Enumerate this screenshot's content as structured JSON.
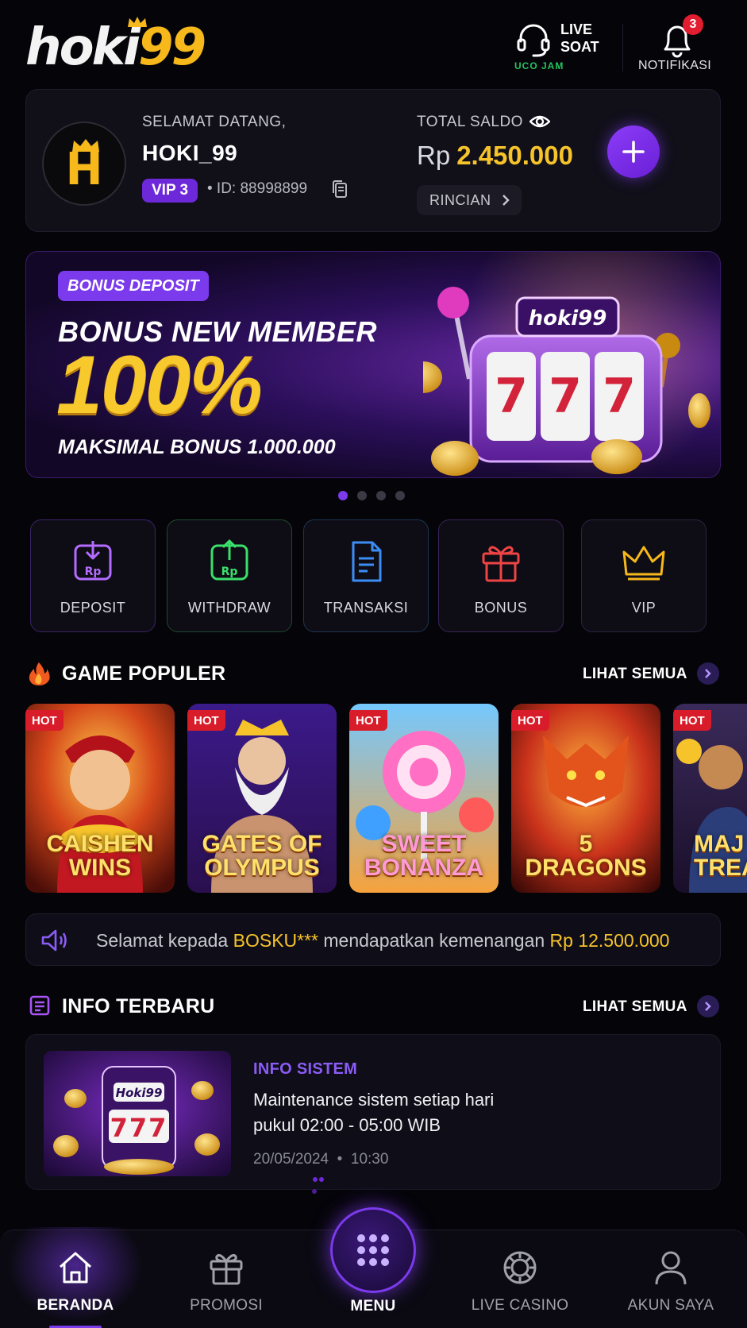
{
  "header": {
    "logo": {
      "part1": "hoki",
      "part2": "99"
    },
    "live_chat": {
      "label": "LIVE\nSOAT",
      "sub": "UCO JAM"
    },
    "notifications": {
      "label": "NOTIFIKASI",
      "count": "3"
    }
  },
  "account": {
    "welcome": "SELAMAT DATANG,",
    "username": "HOKI_99",
    "avatar_letter": "H",
    "vip": "VIP 3",
    "user_id": "• ID: 88998899",
    "saldo_label": "TOTAL SALDO",
    "currency": "Rp",
    "balance": "2.450.000",
    "rincian": "RINCIAN"
  },
  "banner": {
    "tag": "BONUS DEPOSIT",
    "title": "BONUS NEW MEMBER",
    "percent": "100%",
    "subtitle": "MAKSIMAL BONUS 1.000.000",
    "machine_logo": "hoki99",
    "slides_total": 4,
    "slide_active": 1
  },
  "quick_actions": [
    {
      "label": "DEPOSIT",
      "icon": "deposit-icon",
      "color": "#a855f7"
    },
    {
      "label": "WITHDRAW",
      "icon": "withdraw-icon",
      "color": "#22c55e"
    },
    {
      "label": "TRANSAKSI",
      "icon": "transaction-icon",
      "color": "#3b82f6"
    },
    {
      "label": "BONUS",
      "icon": "gift-icon",
      "color": "#ef4444"
    },
    {
      "label": "VIP",
      "icon": "crown-icon",
      "color": "#f6b81a"
    }
  ],
  "popular_games": {
    "title": "GAME POPULER",
    "see_all": "LIHAT SEMUA",
    "items": [
      {
        "name": "CAISHEN\nWINS",
        "badge": "HOT"
      },
      {
        "name": "GATES OF\nOLYMPUS",
        "badge": "HOT"
      },
      {
        "name": "SWEET\nBONANZA",
        "badge": "HOT"
      },
      {
        "name": "5\nDRAGONS",
        "badge": "HOT"
      },
      {
        "name": "MAJ\nTREAS",
        "badge": "HOT"
      }
    ]
  },
  "ticker": {
    "prefix": "Selamat kepada ",
    "name": "BOSKU***",
    "middle": " mendapatkan kemenangan ",
    "amount": "Rp 12.500.000"
  },
  "info": {
    "title": "INFO TERBARU",
    "see_all": "LIHAT SEMUA",
    "item": {
      "category": "INFO SISTEM",
      "headline": "Maintenance sistem setiap hari\npukul 02:00 - 05:00 WIB",
      "date": "20/05/2024",
      "time": "10:30",
      "thumb_logo": "Hoki99"
    }
  },
  "bottom_nav": {
    "items": [
      {
        "label": "BERANDA",
        "icon": "home-icon",
        "active": true
      },
      {
        "label": "PROMOSI",
        "icon": "gift-icon",
        "active": false
      },
      {
        "label": "MENU",
        "icon": "grid-icon",
        "active": false
      },
      {
        "label": "LIVE CASINO",
        "icon": "casino-chip-icon",
        "active": false
      },
      {
        "label": "AKUN SAYA",
        "icon": "user-icon",
        "active": false
      }
    ]
  },
  "colors": {
    "accent": "#7c3aed",
    "gold": "#f6c32a",
    "background": "#050409",
    "hot_badge": "#d91c2a"
  }
}
